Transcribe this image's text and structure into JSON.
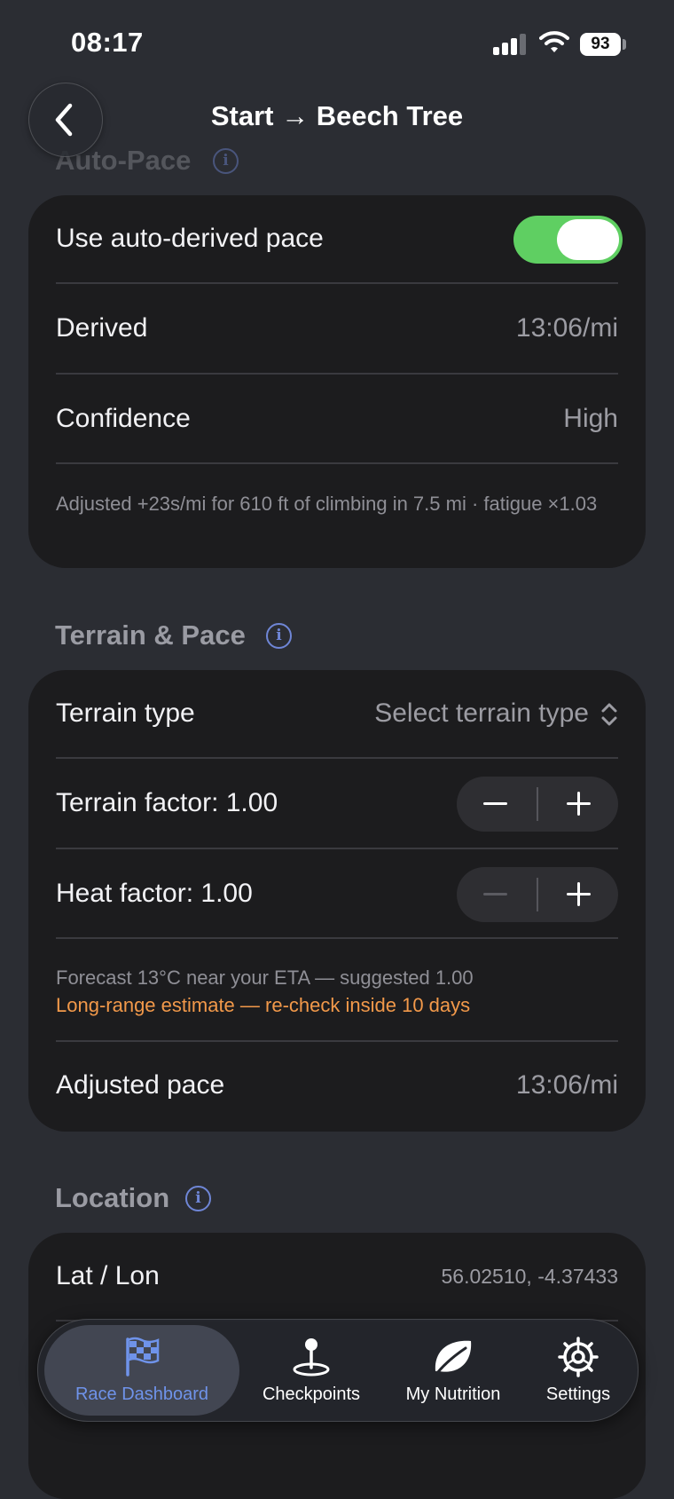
{
  "status_bar": {
    "time": "08:17",
    "battery": "93"
  },
  "nav": {
    "title": "Start → Beech Tree"
  },
  "auto_pace": {
    "section_title": "Auto-Pace",
    "use_auto_label": "Use auto-derived pace",
    "use_auto_enabled": true,
    "derived_label": "Derived",
    "derived_value": "13:06/mi",
    "confidence_label": "Confidence",
    "confidence_value": "High",
    "note": "Adjusted +23s/mi for 610 ft of climbing in 7.5 mi · fatigue ×1.03"
  },
  "terrain_pace": {
    "section_title": "Terrain & Pace",
    "terrain_type_label": "Terrain type",
    "terrain_type_value": "Select terrain type",
    "terrain_factor_label": "Terrain factor: 1.00",
    "heat_factor_label": "Heat factor: 1.00",
    "forecast_note": "Forecast 13°C near your ETA — suggested 1.00",
    "forecast_warning": "Long-range estimate — re-check inside 10 days",
    "adjusted_pace_label": "Adjusted pace",
    "adjusted_pace_value": "13:06/mi"
  },
  "location": {
    "section_title": "Location",
    "latlon_label": "Lat / Lon",
    "latlon_value": "56.02510, -4.37433"
  },
  "tabs": [
    {
      "label": "Race Dashboard",
      "icon": "checkered-flag-icon",
      "active": true
    },
    {
      "label": "Checkpoints",
      "icon": "map-pin-icon",
      "active": false
    },
    {
      "label": "My Nutrition",
      "icon": "leaf-icon",
      "active": false
    },
    {
      "label": "Settings",
      "icon": "gear-icon",
      "active": false
    }
  ],
  "colors": {
    "background": "#2b2d33",
    "card": "#1c1c1e",
    "toggle_on": "#5fcf62",
    "info_accent": "#6f86d6",
    "warning": "#f2994a",
    "tab_active": "#6f93ea"
  }
}
